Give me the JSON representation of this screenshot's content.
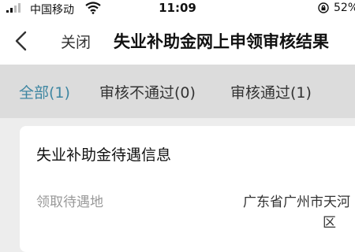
{
  "status_bar": {
    "carrier": "中国移动",
    "time": "11:09",
    "battery": "52%",
    "icons": [
      "signal-icon",
      "wifi-icon",
      "rotation-lock-icon"
    ]
  },
  "nav": {
    "close_label": "关闭",
    "title": "失业补助金网上申领审核结果",
    "back_icon": "chevron-left-icon"
  },
  "tabs": [
    {
      "label": "全部(1)",
      "active": true
    },
    {
      "label": "审核不通过(0)",
      "active": false
    },
    {
      "label": "审核通过(1)",
      "active": false
    }
  ],
  "card": {
    "title": "失业补助金待遇信息",
    "fields": [
      {
        "label": "领取待遇地",
        "value_line1": "广东省广州市天河",
        "value_line2": "区"
      }
    ]
  },
  "colors": {
    "accent": "#3e86a2",
    "tab_bar_bg": "#dcdcdc",
    "page_bg": "#ededed"
  }
}
